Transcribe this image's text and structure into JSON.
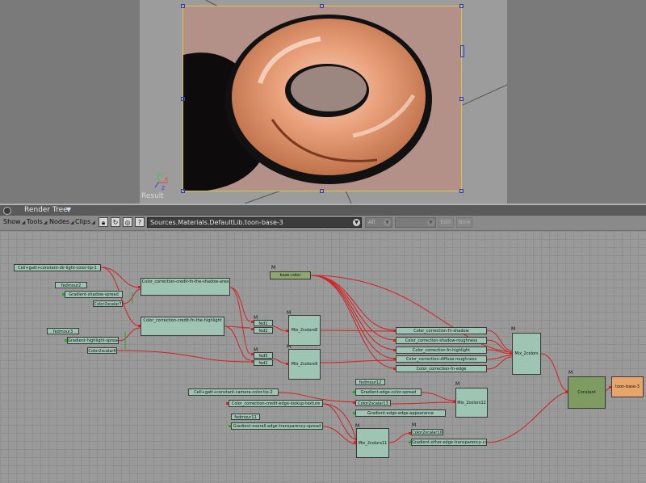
{
  "viewport": {
    "result_label": "Result",
    "axis_labels": {
      "x": "X",
      "y": "Y",
      "z": "Z"
    },
    "colors": {
      "frame_border": "#d8c84a",
      "handles": "#2a3cc8",
      "torus": "#e9a07a"
    }
  },
  "render_tree": {
    "title": "Render Tree",
    "menus": [
      "Show",
      "Tools",
      "Nodes",
      "Clips"
    ],
    "toolbar_icons": [
      "lock-icon",
      "refresh-icon",
      "clear-icon",
      "help-icon"
    ],
    "help_glyph": "?",
    "path": "Sources.Materials.DefaultLib.toon-base-3",
    "filter_value": "All",
    "buttons": {
      "edit": "Edit",
      "new": "New"
    }
  },
  "nodes": {
    "n1": "Cell+gatt+constant-dir-light-color-tip-1",
    "n2": "fedmour2",
    "n3": "Gradient-shadow-spread",
    "n4": "Color2scalar7",
    "n5": "Color_correction-credit-fn-the-shadow-area",
    "n6": "fedmour3",
    "n7": "Gradient-highlight-spread",
    "n8": "Color2scalar6",
    "n9": "Color_correction-credit-fn-the-highlight",
    "n10": "base-color",
    "n11": "fed1",
    "n12": "fed2",
    "n13": "fed5",
    "n14": "fed2",
    "n15": "Mix_2colors8",
    "n16": "Mix_2colors9",
    "n17": "Color_correction-fn-shadow",
    "n18": "Color_correction-shadow-roughness",
    "n19": "Color_correction-fn-highlight",
    "n20": "Color_correction-diffuse-roughness",
    "n21": "Color_correction-fn-edge",
    "n22": "Mix_2colors",
    "n23": "fedmour12",
    "n24": "Gradient-edge-color-spread",
    "n25": "Color2scalar13",
    "n26": "Gradient-edge-edge-appearance",
    "n27": "Mix_2colors12",
    "n28": "Cell+gatt+constant-camera-color-tip-2",
    "n29": "Color_correction-credit-edge-lookup-texture",
    "n30": "fedmour11",
    "n31": "Gradient-overall-edge-transparency-spread",
    "n32": "Mix_2colors11",
    "n33": "Color2scalar10",
    "n34": "Gradient-other-edge-transparency-control",
    "n35": "Constant",
    "n36": "toon-base-3",
    "m": "M"
  }
}
